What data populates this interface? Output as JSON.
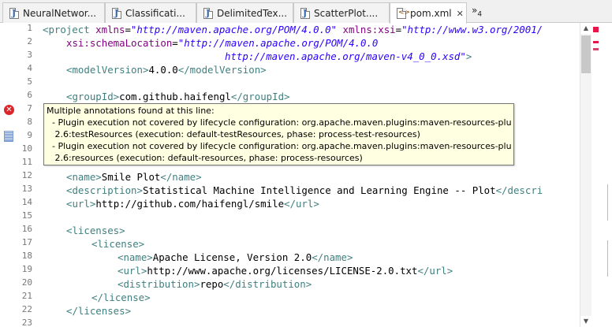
{
  "tabs": [
    {
      "label": "NeuralNetwor...",
      "icon": "java-file-icon",
      "active": false
    },
    {
      "label": "Classificati...",
      "icon": "java-file-icon",
      "active": false
    },
    {
      "label": "DelimitedTex...",
      "icon": "java-file-icon",
      "active": false
    },
    {
      "label": "ScatterPlot....",
      "icon": "java-file-icon",
      "active": false
    },
    {
      "label": "pom.xml",
      "icon": "xml-file-icon",
      "active": true,
      "close": "✕"
    }
  ],
  "overflow": {
    "chevron": "»",
    "count": "4"
  },
  "line_numbers": [
    "1",
    "2",
    "3",
    "4",
    "5",
    "6",
    "7",
    "8",
    "9",
    "10",
    "11",
    "12",
    "13",
    "14",
    "15",
    "16",
    "17",
    "18",
    "19",
    "20",
    "21",
    "22",
    "23"
  ],
  "code": {
    "l1": [
      "<project ",
      "xmlns",
      "=",
      "\"http://maven.apache.org/POM/4.0.0\"",
      " ",
      "xmlns:xsi",
      "=",
      "\"http://www.w3.org/2001/"
    ],
    "l2": [
      "xsi:schemaLocation",
      "=",
      "\"http://maven.apache.org/POM/4.0.0"
    ],
    "l3": [
      "http://maven.apache.org/maven-v4_0_0.xsd\"",
      ">"
    ],
    "l4": [
      "<modelVersion>",
      "4.0.0",
      "</modelVersion>"
    ],
    "l6": [
      "<groupId>",
      "com.github.haifengl",
      "</groupId>"
    ],
    "l11": [
      "<name>",
      "Smile Plot",
      "</name>"
    ],
    "l12": [
      "<description>",
      "Statistical Machine Intelligence and Learning Engine -- Plot",
      "</descri"
    ],
    "l13": [
      "<url>",
      "http://github.com/haifengl/smile",
      "</url>"
    ],
    "l15": [
      "<licenses>"
    ],
    "l16": [
      "<license>"
    ],
    "l17": [
      "<name>",
      "Apache License, Version 2.0",
      "</name>"
    ],
    "l18": [
      "<url>",
      "http://www.apache.org/licenses/LICENSE-2.0.txt",
      "</url>"
    ],
    "l19": [
      "<distribution>",
      "repo",
      "</distribution>"
    ],
    "l20": [
      "</license>"
    ],
    "l21": [
      "</licenses>"
    ]
  },
  "hover": {
    "lines": [
      "Multiple annotations found at this line:",
      "  - Plugin execution not covered by lifecycle configuration: org.apache.maven.plugins:maven-resources-plugin:",
      "   2.6:testResources (execution: default-testResources, phase: process-test-resources)",
      "  - Plugin execution not covered by lifecycle configuration: org.apache.maven.plugins:maven-resources-plugin:",
      "   2.6:resources (execution: default-resources, phase: process-resources)"
    ]
  },
  "markers": {
    "error_glyph": "✕"
  },
  "scrollbar": {
    "up": "▲",
    "down": "▼"
  },
  "colors": {
    "tag": "#3f7f7f",
    "attr": "#7f007f",
    "value": "#2a00ff",
    "error": "#e8154a",
    "hover_bg": "#ffffe1"
  }
}
